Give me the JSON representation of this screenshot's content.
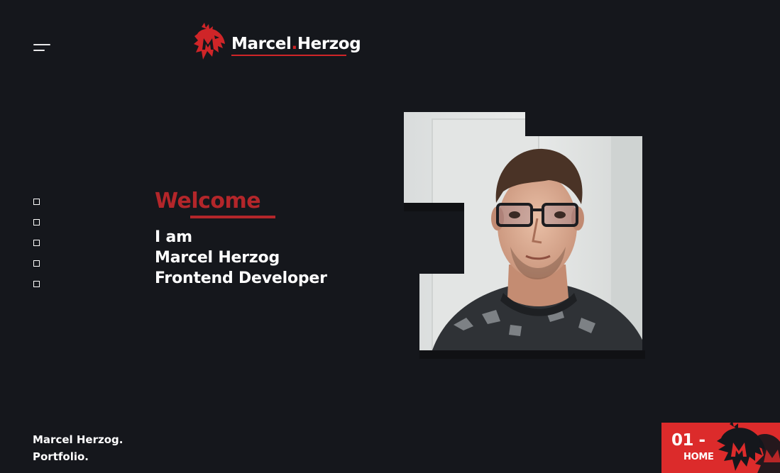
{
  "header": {
    "menu_icon": "hamburger-menu-icon",
    "logo": {
      "icon": "dragon-logo-icon",
      "first_name": "Marcel",
      "dot": ".",
      "last_name": "Herzog"
    }
  },
  "section_nav": {
    "items": [
      {
        "icon": "square-outline-icon"
      },
      {
        "icon": "square-outline-icon"
      },
      {
        "icon": "square-outline-icon"
      },
      {
        "icon": "square-outline-icon"
      },
      {
        "icon": "square-outline-icon"
      }
    ]
  },
  "hero": {
    "welcome": "Welcome",
    "line1": "I am",
    "line2": "Marcel Herzog",
    "line3": "Frontend Developer"
  },
  "portrait": {
    "icon": "portrait-photo"
  },
  "footer": {
    "line1": "Marcel Herzog.",
    "line2": "Portfolio."
  },
  "page_indicator": {
    "number": "01 -",
    "label": "HOME",
    "icon": "dragon-watermark-icon"
  },
  "colors": {
    "background": "#15171c",
    "accent": "#cf2528",
    "accent_dark": "#b3262a",
    "text": "#ffffff"
  }
}
